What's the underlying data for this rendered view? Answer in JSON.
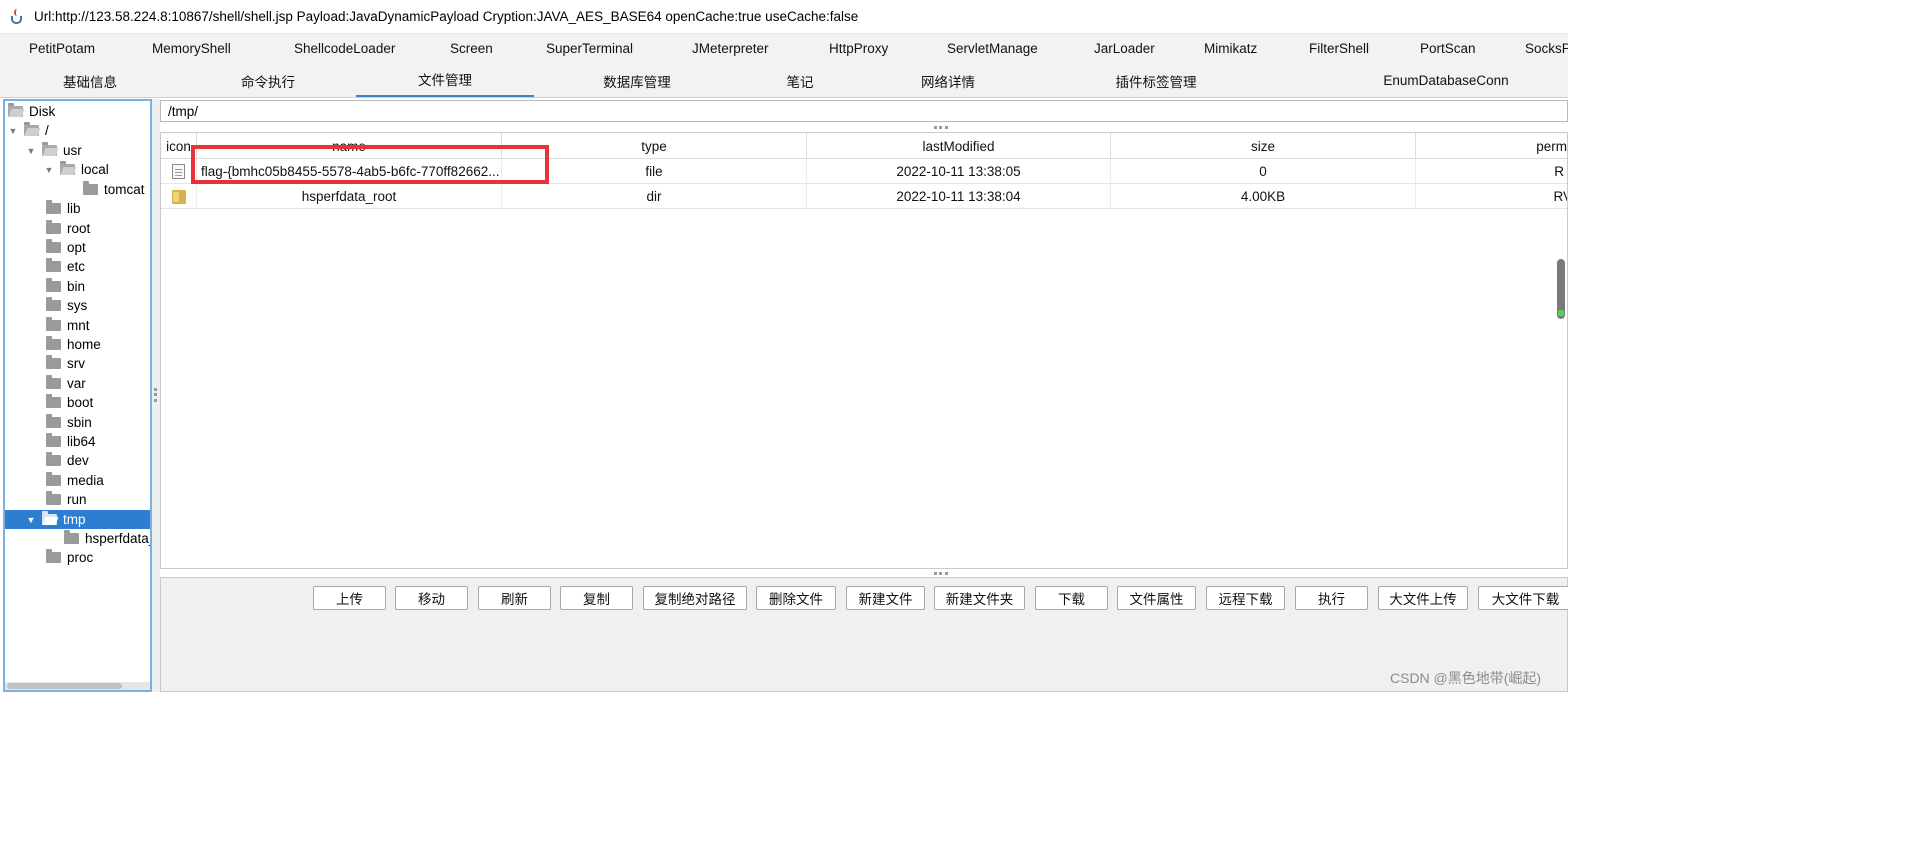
{
  "window": {
    "title": "Url:http://123.58.224.8:10867/shell/shell.jsp Payload:JavaDynamicPayload Cryption:JAVA_AES_BASE64 openCache:true useCache:false"
  },
  "plugin_tabs": [
    "PetitPotam",
    "MemoryShell",
    "ShellcodeLoader",
    "Screen",
    "SuperTerminal",
    "JMeterpreter",
    "HttpProxy",
    "ServletManage",
    "JarLoader",
    "Mimikatz",
    "FilterShell",
    "PortScan",
    "SocksP"
  ],
  "main_tabs": [
    "基础信息",
    "命令执行",
    "文件管理",
    "数据库管理",
    "笔记",
    "网络详情",
    "插件标签管理",
    "EnumDatabaseConn"
  ],
  "active_main_tab": "文件管理",
  "tree": {
    "root": "Disk",
    "nodes": [
      "/",
      "usr",
      "local",
      "tomcat",
      "lib",
      "root",
      "opt",
      "etc",
      "bin",
      "sys",
      "mnt",
      "home",
      "srv",
      "var",
      "boot",
      "sbin",
      "lib64",
      "dev",
      "media",
      "run",
      "tmp",
      "hsperfdata_",
      "proc"
    ],
    "selected": "tmp"
  },
  "path": "/tmp/",
  "table": {
    "columns": [
      "icon",
      "name",
      "type",
      "lastModified",
      "size",
      "perm"
    ],
    "rows": [
      {
        "icon": "file-icon",
        "name": "flag-{bmhc05b8455-5578-4ab5-b6fc-770ff82662...",
        "type": "file",
        "lastModified": "2022-10-11 13:38:05",
        "size": "0",
        "perm": "R"
      },
      {
        "icon": "folder-icon",
        "name": "hsperfdata_root",
        "type": "dir",
        "lastModified": "2022-10-11 13:38:04",
        "size": "4.00KB",
        "perm": "RV"
      }
    ]
  },
  "buttons": [
    "上传",
    "移动",
    "刷新",
    "复制",
    "复制绝对路径",
    "删除文件",
    "新建文件",
    "新建文件夹",
    "下载",
    "文件属性",
    "远程下载",
    "执行",
    "大文件上传",
    "大文件下载"
  ],
  "watermark": "CSDN @黑色地带(崛起)",
  "colors": {
    "accent": "#3c82cf",
    "selection": "#2c7ed0",
    "highlight_box": "#e8333b",
    "tree_border": "#7ab0e4"
  }
}
